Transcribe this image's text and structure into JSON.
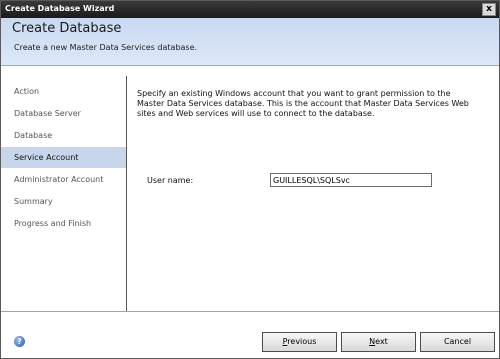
{
  "window": {
    "title": "Create Database Wizard",
    "close_glyph": "x"
  },
  "header": {
    "title": "Create Database",
    "subtitle": "Create a new Master Data Services database."
  },
  "sidebar": {
    "items": [
      {
        "label": "Action",
        "active": false
      },
      {
        "label": "Database Server",
        "active": false
      },
      {
        "label": "Database",
        "active": false
      },
      {
        "label": "Service Account",
        "active": true
      },
      {
        "label": "Administrator Account",
        "active": false
      },
      {
        "label": "Summary",
        "active": false
      },
      {
        "label": "Progress and Finish",
        "active": false
      }
    ]
  },
  "main": {
    "description": "Specify an existing Windows account that you want to grant permission to the Master Data Services database. This is the account that Master Data Services Web sites and Web services will use to connect to the database.",
    "username_label": "User name:",
    "username_value": "GUILLESQL\\SQLSvc"
  },
  "footer": {
    "help_glyph": "?",
    "previous_prefix": "",
    "previous_key": "P",
    "previous_rest": "revious",
    "next_prefix": "",
    "next_key": "N",
    "next_rest": "ext",
    "cancel_label": "Cancel"
  },
  "colors": {
    "titlebar": "#2a2a2a",
    "header_bg": "#d3e1f5",
    "active_item_bg": "#c8d6eb"
  }
}
